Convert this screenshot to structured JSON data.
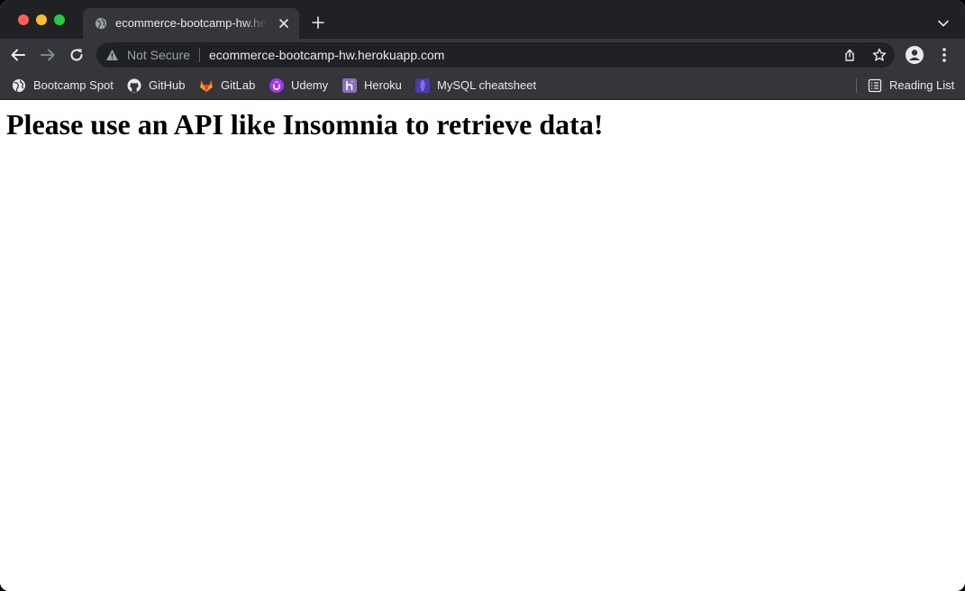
{
  "window": {
    "traffic_lights": [
      "close",
      "minimize",
      "zoom"
    ]
  },
  "tab": {
    "title": "ecommerce-bootcamp-hw.herokuapp.com",
    "favicon": "globe-icon"
  },
  "omnibox": {
    "security_label": "Not Secure",
    "url": "ecommerce-bootcamp-hw.herokuapp.com"
  },
  "bookmarks": {
    "items": [
      {
        "label": "Bootcamp Spot",
        "icon": "globe-icon"
      },
      {
        "label": "GitHub",
        "icon": "github-icon"
      },
      {
        "label": "GitLab",
        "icon": "gitlab-icon"
      },
      {
        "label": "Udemy",
        "icon": "udemy-icon"
      },
      {
        "label": "Heroku",
        "icon": "heroku-icon"
      },
      {
        "label": "MySQL cheatsheet",
        "icon": "mysql-icon"
      }
    ],
    "reading_list": "Reading List"
  },
  "page": {
    "heading": "Please use an API like Insomnia to retrieve data!"
  },
  "colors": {
    "tabstrip_bg": "#202124",
    "toolbar_bg": "#35363a",
    "text_light": "#e8eaed",
    "text_muted": "#9aa0a6",
    "page_bg": "#ffffff"
  }
}
